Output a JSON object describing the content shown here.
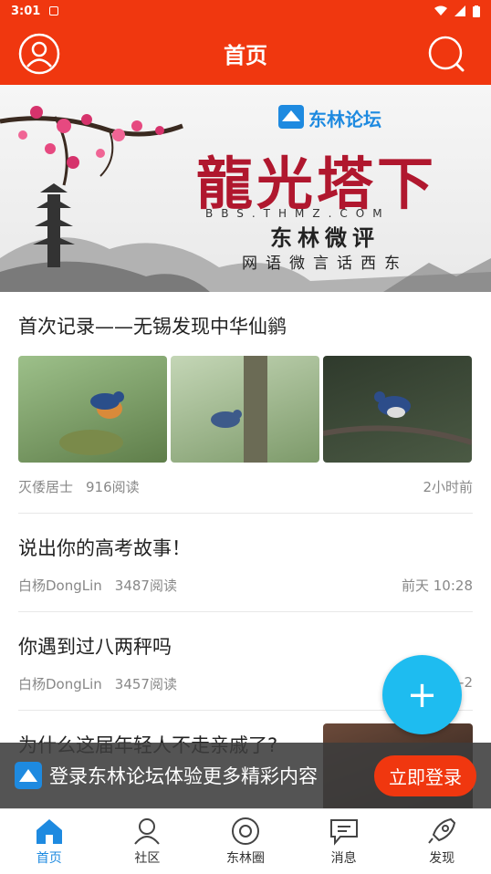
{
  "status": {
    "time": "3:01"
  },
  "appbar": {
    "title": "首页"
  },
  "banner": {
    "logo_text": "东林论坛",
    "headline": "龍光塔下",
    "url": "BBS.THMZ.COM",
    "subtitle": "东林微评",
    "tagline": "网语微言话西东"
  },
  "posts": [
    {
      "title": "首次记录——无锡发现中华仙鹟",
      "author": "灭倭居士",
      "reads": "916阅读",
      "time": "2小时前"
    },
    {
      "title": "说出你的高考故事！",
      "author": "白杨DongLin",
      "reads": "3487阅读",
      "time": "前天 10:28"
    },
    {
      "title": "你遇到过八两秤吗",
      "author": "白杨DongLin",
      "reads": "3457阅读",
      "time": "-2"
    },
    {
      "title": "为什么这届年轻人不走亲戚了?"
    }
  ],
  "fab": {
    "label": "+"
  },
  "login": {
    "text": "登录东林论坛体验更多精彩内容",
    "button": "立即登录"
  },
  "tabs": [
    {
      "label": "首页"
    },
    {
      "label": "社区"
    },
    {
      "label": "东林圈"
    },
    {
      "label": "消息"
    },
    {
      "label": "发现"
    }
  ]
}
